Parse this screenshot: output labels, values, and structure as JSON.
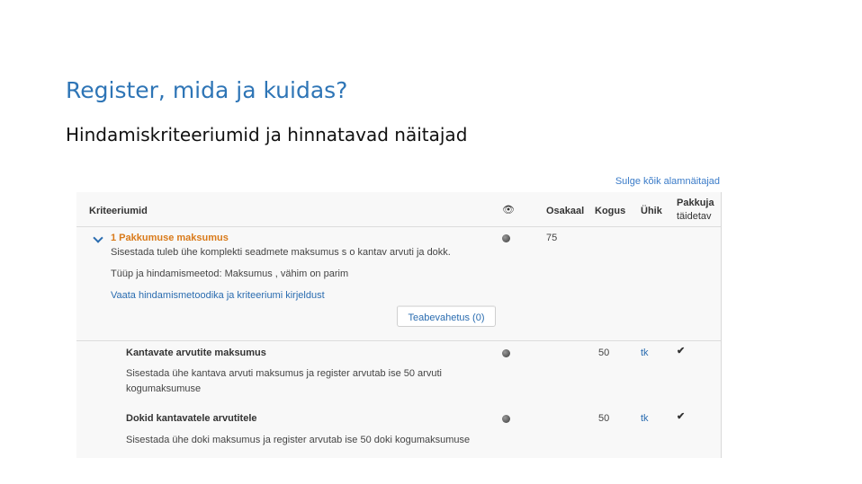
{
  "slide": {
    "title": "Register, mida ja kuidas?",
    "subtitle": "Hindamiskriteeriumid ja hinnatavad näitajad"
  },
  "top_link": "Sulge kõik alamnäitajad",
  "table": {
    "headers": {
      "criteria": "Kriteeriumid",
      "eye_icon": "eye-icon",
      "weight": "Osakaal",
      "quantity": "Kogus",
      "unit": "Ühik",
      "supplier_fills_line1": "Pakkuja",
      "supplier_fills_line2": "täidetav"
    },
    "criterion": {
      "title": "1 Pakkumuse maksumus",
      "description": "Sisestada tuleb ühe komplekti seadmete maksumus s o kantav arvuti ja dokk.",
      "method": "Tüüp ja hindamismeetod: Maksumus , vähim on parim",
      "methodology_link": "Vaata hindamismetoodika ja kriteeriumi kirjeldust",
      "weight": "75",
      "info_button": "Teabevahetus (0)"
    },
    "subcriteria": [
      {
        "title": "Kantavate arvutite maksumus",
        "desc_line1": "Sisestada ühe kantava arvuti maksumus ja register arvutab ise 50 arvuti",
        "desc_line2": "kogumaksumuse",
        "quantity": "50",
        "unit": "tk"
      },
      {
        "title": "Dokid kantavatele arvutitele",
        "desc_line1": "Sisestada ühe doki maksumus ja register arvutab ise 50 doki kogumaksumuse",
        "quantity": "50",
        "unit": "tk"
      }
    ]
  }
}
